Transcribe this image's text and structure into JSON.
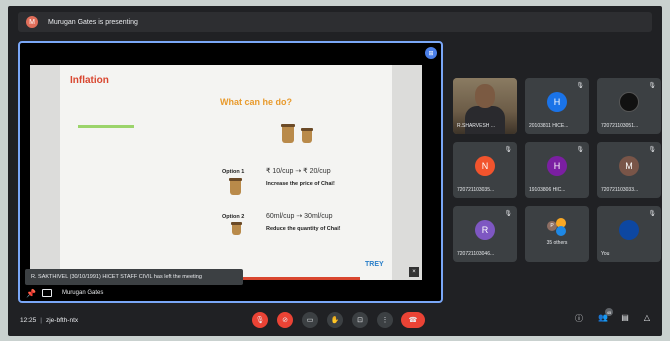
{
  "banner": {
    "text": "Murugan Gates is presenting",
    "avatar_letter": "M"
  },
  "presentation": {
    "pin_badge": "⊞",
    "slide": {
      "title": "Inflation",
      "question": "What can he do?",
      "option1_label": "Option 1",
      "option1_line1": "₹ 10/cup  ⇢  ₹ 20/cup",
      "option1_line2": "Increase the price of Chai!",
      "option2_label": "Option 2",
      "option2_line1": "60ml/cup  ⇢  30ml/cup",
      "option2_line2": "Reduce the quantity of Chai!",
      "logo": "TREY",
      "close_glyph": "×"
    },
    "toast": "R. SAKTHIVEL (30/10/1991) HICET STAFF CIVIL has left the meeting",
    "footer_name": "Murugan Gates"
  },
  "participants": [
    {
      "name": "R.SHARVESH ...",
      "type": "video"
    },
    {
      "name": "20103811 HICE...",
      "letter": "H",
      "color": "#1a73e8"
    },
    {
      "name": "720721103051...",
      "type": "photo",
      "color": "#111"
    },
    {
      "name": "720721103035...",
      "letter": "N",
      "color": "#f2542d"
    },
    {
      "name": "19103806 HIC...",
      "letter": "H",
      "color": "#7b1fa2"
    },
    {
      "name": "720721103033...",
      "letter": "M",
      "color": "#795548"
    },
    {
      "name": "720721103046...",
      "letter": "R",
      "color": "#7e57c2"
    },
    {
      "name": "35 others",
      "type": "others"
    },
    {
      "name": "You",
      "type": "photo-you",
      "color": "#0d47a1"
    }
  ],
  "bottom": {
    "time": "12:25",
    "meeting_code": "zje-bfth-ntx",
    "participant_count": "45"
  },
  "icons": {
    "mic": "🎙",
    "cam": "⊘",
    "cc": "▭",
    "hand": "✋",
    "present": "⊡",
    "more": "⋮",
    "hangup": "☎",
    "info": "ⓘ",
    "people": "👥",
    "chat": "▤",
    "activities": "△"
  }
}
